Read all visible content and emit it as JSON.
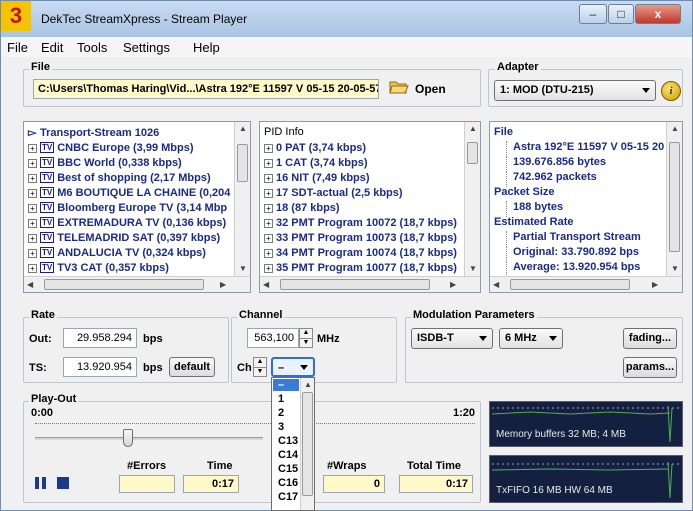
{
  "badge": "3",
  "window": {
    "title": "DekTec StreamXpress - Stream Player"
  },
  "menu": [
    "File",
    "Edit",
    "Tools",
    "Settings",
    "Help"
  ],
  "file": {
    "label": "File",
    "path": "C:\\Users\\Thomas Haring\\Vid...\\Astra 192°E 11597 V 05-15 20-05-57.ts",
    "open_label": "Open"
  },
  "adapter": {
    "label": "Adapter",
    "value": "1: MOD  (DTU-215)"
  },
  "transport": {
    "root": "Transport-Stream  1026",
    "services": [
      "CNBC Europe (3,99 Mbps)",
      "BBC World (0,338 kbps)",
      "Best of shopping (2,17 Mbps)",
      "M6 BOUTIQUE LA CHAINE (0,204",
      "Bloomberg Europe TV (3,14 Mbp",
      "EXTREMADURA TV (0,136 kbps)",
      "TELEMADRID SAT (0,397 kbps)",
      "ANDALUCIA TV (0,324 kbps)",
      "TV3 CAT (0,357 kbps)"
    ]
  },
  "pid": {
    "header": "PID Info",
    "items": [
      "0 PAT  (3,74 kbps)",
      "1 CAT  (3,74 kbps)",
      "16 NIT  (7,49 kbps)",
      "17 SDT-actual  (2,5 kbps)",
      "18  (87 kbps)",
      "32 PMT Program 10072  (18,7 kbps)",
      "33 PMT Program 10073  (18,7 kbps)",
      "34 PMT Program 10074  (18,7 kbps)",
      "35 PMT Program 10077  (18,7 kbps)"
    ]
  },
  "fileinfo": {
    "file_header": "File",
    "file_items": [
      "Astra 192°E 11597 V 05-15 20",
      "139.676.856 bytes",
      "742.962 packets"
    ],
    "packet_header": "Packet Size",
    "packet_items": [
      "188 bytes"
    ],
    "rate_header": "Estimated Rate",
    "rate_items": [
      "Partial Transport Stream",
      "Original: 33.790.892 bps",
      "Average: 13.920.954 bps"
    ]
  },
  "rate": {
    "label": "Rate",
    "out_label": "Out:",
    "out_value": "29.958.294",
    "out_unit": "bps",
    "ts_label": "TS:",
    "ts_value": "13.920.954",
    "ts_unit": "bps",
    "default_label": "default"
  },
  "channel": {
    "label": "Channel",
    "freq": "563,100",
    "unit": "MHz",
    "ch_label": "Ch",
    "ch_value": "–",
    "options": [
      "–",
      "1",
      "2",
      "3",
      "C13",
      "C14",
      "C15",
      "C16",
      "C17"
    ]
  },
  "modulation": {
    "label": "Modulation Parameters",
    "standard": "ISDB-T",
    "bandwidth": "6 MHz",
    "fading_label": "fading...",
    "params_label": "params..."
  },
  "playout": {
    "label": "Play-Out",
    "start_time": "0:00",
    "end_time": "1:20",
    "position": 0.08,
    "errors_label": "#Errors",
    "time_label": "Time",
    "time_value": "0:17",
    "wraps_label": "#Wraps",
    "wraps_value": "0",
    "total_label": "Total Time",
    "total_value": "0:17"
  },
  "monitors": {
    "memory": "Memory buffers 32 MB; 4 MB",
    "fifo": "TxFIFO 16 MB   HW 64 MB"
  },
  "colors": {
    "badge": "#f5c400",
    "badge_text": "#c8102e",
    "yellow_field": "#fff8c8",
    "selection": "#3a7bd5",
    "monitor_bg": "#142040"
  }
}
